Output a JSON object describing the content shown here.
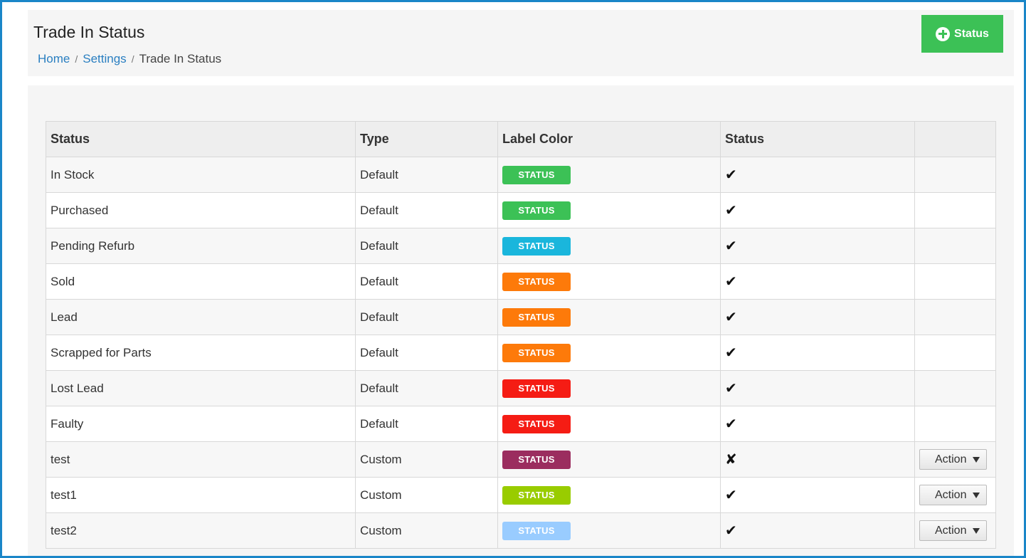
{
  "page": {
    "title": "Trade In Status",
    "breadcrumb": [
      {
        "label": "Home",
        "link": true
      },
      {
        "label": "Settings",
        "link": true
      },
      {
        "label": "Trade In Status",
        "link": false
      }
    ],
    "add_button_label": "Status",
    "add_button_icon": "plus-circle-icon"
  },
  "table": {
    "headers": [
      "Status",
      "Type",
      "Label Color",
      "Status",
      ""
    ],
    "rows": [
      {
        "name": "In Stock",
        "type": "Default",
        "label": "STATUS",
        "color": "#3cc156",
        "active": true,
        "action": ""
      },
      {
        "name": "Purchased",
        "type": "Default",
        "label": "STATUS",
        "color": "#3cc156",
        "active": true,
        "action": ""
      },
      {
        "name": "Pending Refurb",
        "type": "Default",
        "label": "STATUS",
        "color": "#1ab6dc",
        "active": true,
        "action": ""
      },
      {
        "name": "Sold",
        "type": "Default",
        "label": "STATUS",
        "color": "#fd7a0a",
        "active": true,
        "action": ""
      },
      {
        "name": "Lead",
        "type": "Default",
        "label": "STATUS",
        "color": "#fd7a0a",
        "active": true,
        "action": ""
      },
      {
        "name": "Scrapped for Parts",
        "type": "Default",
        "label": "STATUS",
        "color": "#fd7a0a",
        "active": true,
        "action": ""
      },
      {
        "name": "Lost Lead",
        "type": "Default",
        "label": "STATUS",
        "color": "#f51c14",
        "active": true,
        "action": ""
      },
      {
        "name": "Faulty",
        "type": "Default",
        "label": "STATUS",
        "color": "#f51c14",
        "active": true,
        "action": ""
      },
      {
        "name": "test",
        "type": "Custom",
        "label": "STATUS",
        "color": "#9b2d5f",
        "active": false,
        "action": "Action"
      },
      {
        "name": "test1",
        "type": "Custom",
        "label": "STATUS",
        "color": "#99cc00",
        "active": true,
        "action": "Action"
      },
      {
        "name": "test2",
        "type": "Custom",
        "label": "STATUS",
        "color": "#99ccff",
        "active": true,
        "action": "Action"
      }
    ],
    "active_glyph": "✔",
    "inactive_glyph": "✘"
  }
}
